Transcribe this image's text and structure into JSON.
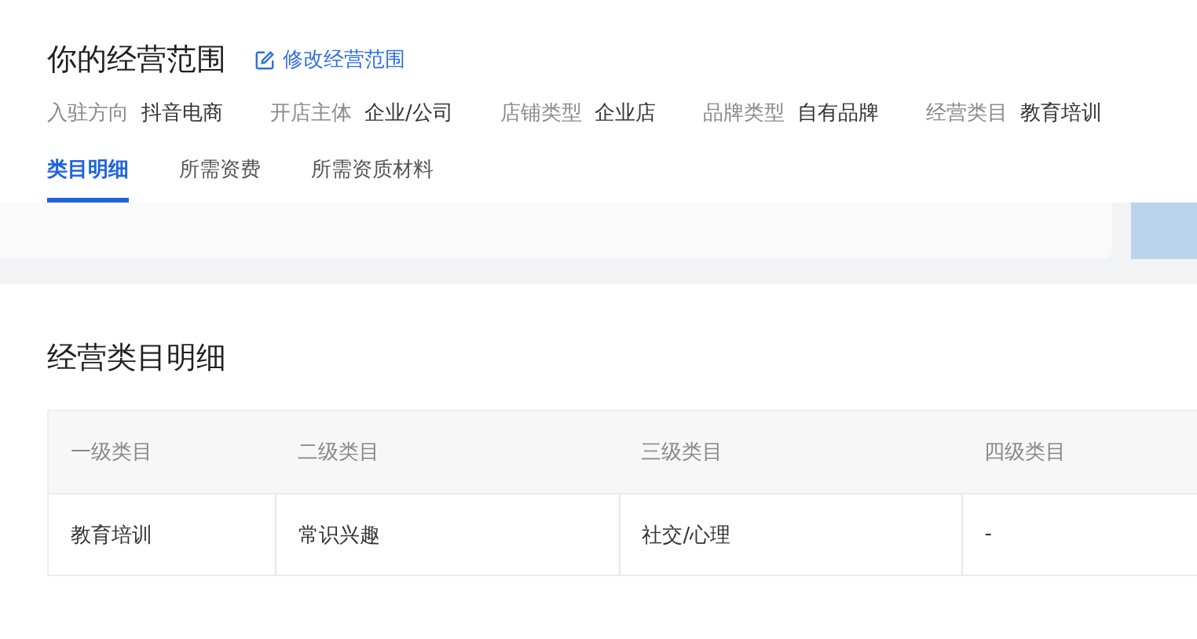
{
  "header": {
    "title": "你的经营范围",
    "edit_link": "修改经营范围"
  },
  "info": [
    {
      "label": "入驻方向",
      "value": "抖音电商"
    },
    {
      "label": "开店主体",
      "value": "企业/公司"
    },
    {
      "label": "店铺类型",
      "value": "企业店"
    },
    {
      "label": "品牌类型",
      "value": "自有品牌"
    },
    {
      "label": "经营类目",
      "value": "教育培训"
    }
  ],
  "tabs": [
    {
      "label": "类目明细",
      "selected": true
    },
    {
      "label": "所需资费",
      "selected": false
    },
    {
      "label": "所需资质材料",
      "selected": false
    }
  ],
  "section": {
    "title": "经营类目明细"
  },
  "table": {
    "columns": [
      "一级类目",
      "二级类目",
      "三级类目",
      "四级类目"
    ],
    "rows": [
      [
        "教育培训",
        "常识兴趣",
        "社交/心理",
        "-"
      ]
    ]
  }
}
